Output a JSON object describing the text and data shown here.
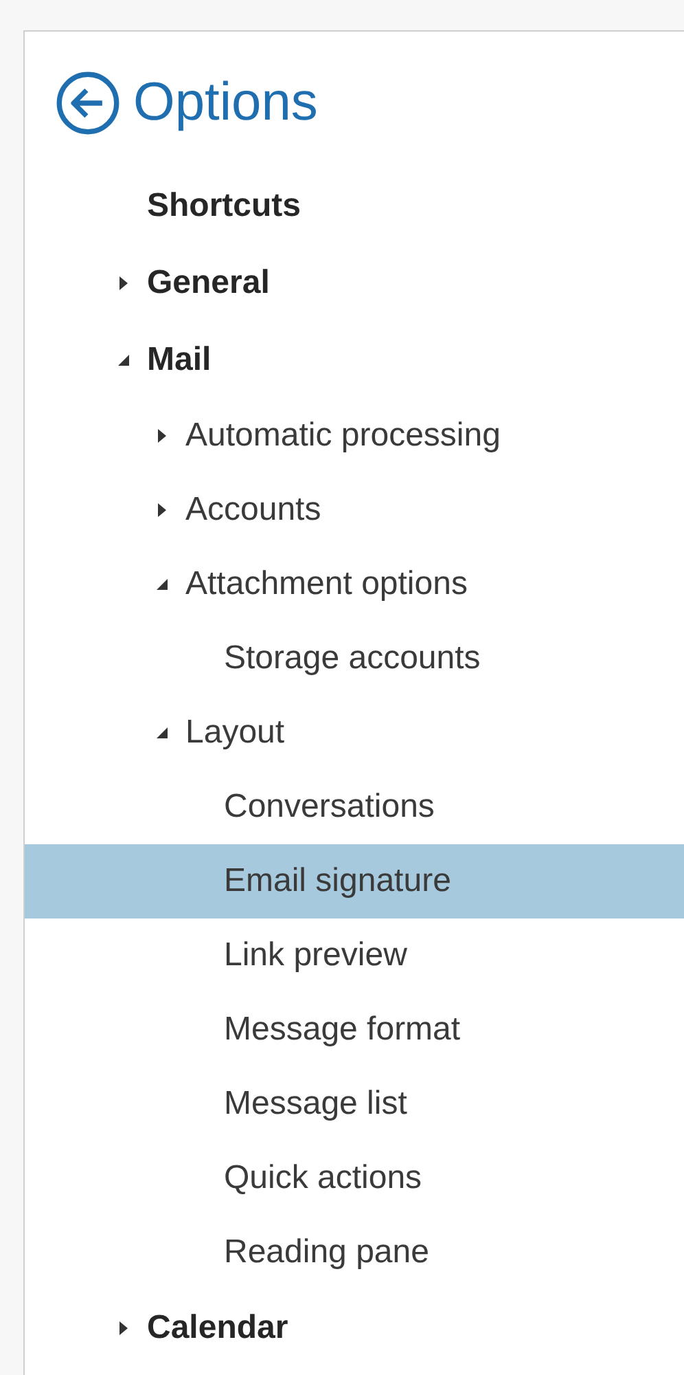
{
  "title": "Options",
  "tree": [
    {
      "label": "Shortcuts",
      "selected": false
    },
    {
      "label": "General",
      "expanded": false,
      "selected": false
    },
    {
      "label": "Mail",
      "expanded": true,
      "selected": false,
      "children": [
        {
          "label": "Automatic processing",
          "expanded": false,
          "selected": false
        },
        {
          "label": "Accounts",
          "expanded": false,
          "selected": false
        },
        {
          "label": "Attachment options",
          "expanded": true,
          "selected": false,
          "children": [
            {
              "label": "Storage accounts",
              "selected": false
            }
          ]
        },
        {
          "label": "Layout",
          "expanded": true,
          "selected": false,
          "children": [
            {
              "label": "Conversations",
              "selected": false
            },
            {
              "label": "Email signature",
              "selected": true
            },
            {
              "label": "Link preview",
              "selected": false
            },
            {
              "label": "Message format",
              "selected": false
            },
            {
              "label": "Message list",
              "selected": false
            },
            {
              "label": "Quick actions",
              "selected": false
            },
            {
              "label": "Reading pane",
              "selected": false
            }
          ]
        }
      ]
    },
    {
      "label": "Calendar",
      "expanded": false,
      "selected": false
    }
  ]
}
